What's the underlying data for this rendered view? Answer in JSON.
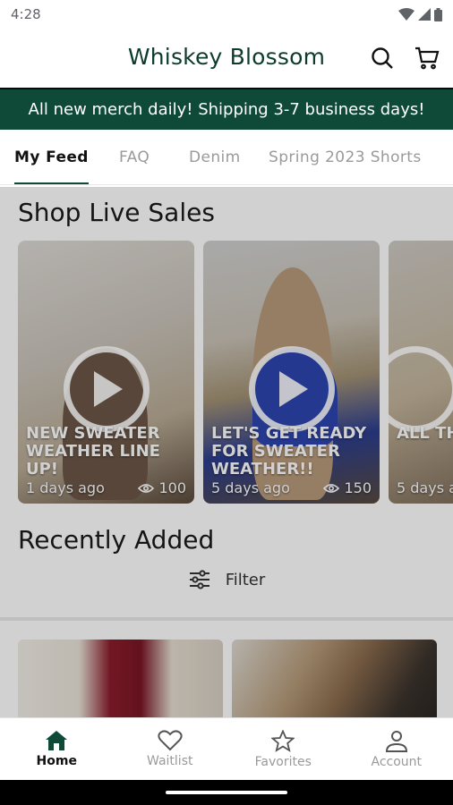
{
  "status_bar": {
    "time": "4:28"
  },
  "header": {
    "title": "Whiskey Blossom"
  },
  "banner": {
    "text": "All new merch daily! Shipping 3-7 business days!"
  },
  "tabs": [
    {
      "label": "My Feed",
      "active": true
    },
    {
      "label": "FAQ"
    },
    {
      "label": "Denim"
    },
    {
      "label": "Spring 2023 Shorts"
    }
  ],
  "live_sales": {
    "title": "Shop Live Sales",
    "cards": [
      {
        "title": "NEW SWEATER WEATHER LINE UP!",
        "time": "1 days ago",
        "views": "100"
      },
      {
        "title": "LET'S GET READY FOR SWEATER WEATHER!!",
        "time": "5 days ago",
        "views": "150"
      },
      {
        "title": "ALL THE MONO",
        "time": "5 days a",
        "views": ""
      }
    ]
  },
  "recently_added": {
    "title": "Recently Added",
    "filter_label": "Filter"
  },
  "bottom_nav": [
    {
      "label": "Home",
      "icon": "home-icon",
      "active": true
    },
    {
      "label": "Waitlist",
      "icon": "heart-icon"
    },
    {
      "label": "Favorites",
      "icon": "star-icon"
    },
    {
      "label": "Account",
      "icon": "account-icon"
    }
  ],
  "colors": {
    "brand": "#0e4a37",
    "banner_text": "#ffffff",
    "inactive": "#9a9a9a"
  }
}
